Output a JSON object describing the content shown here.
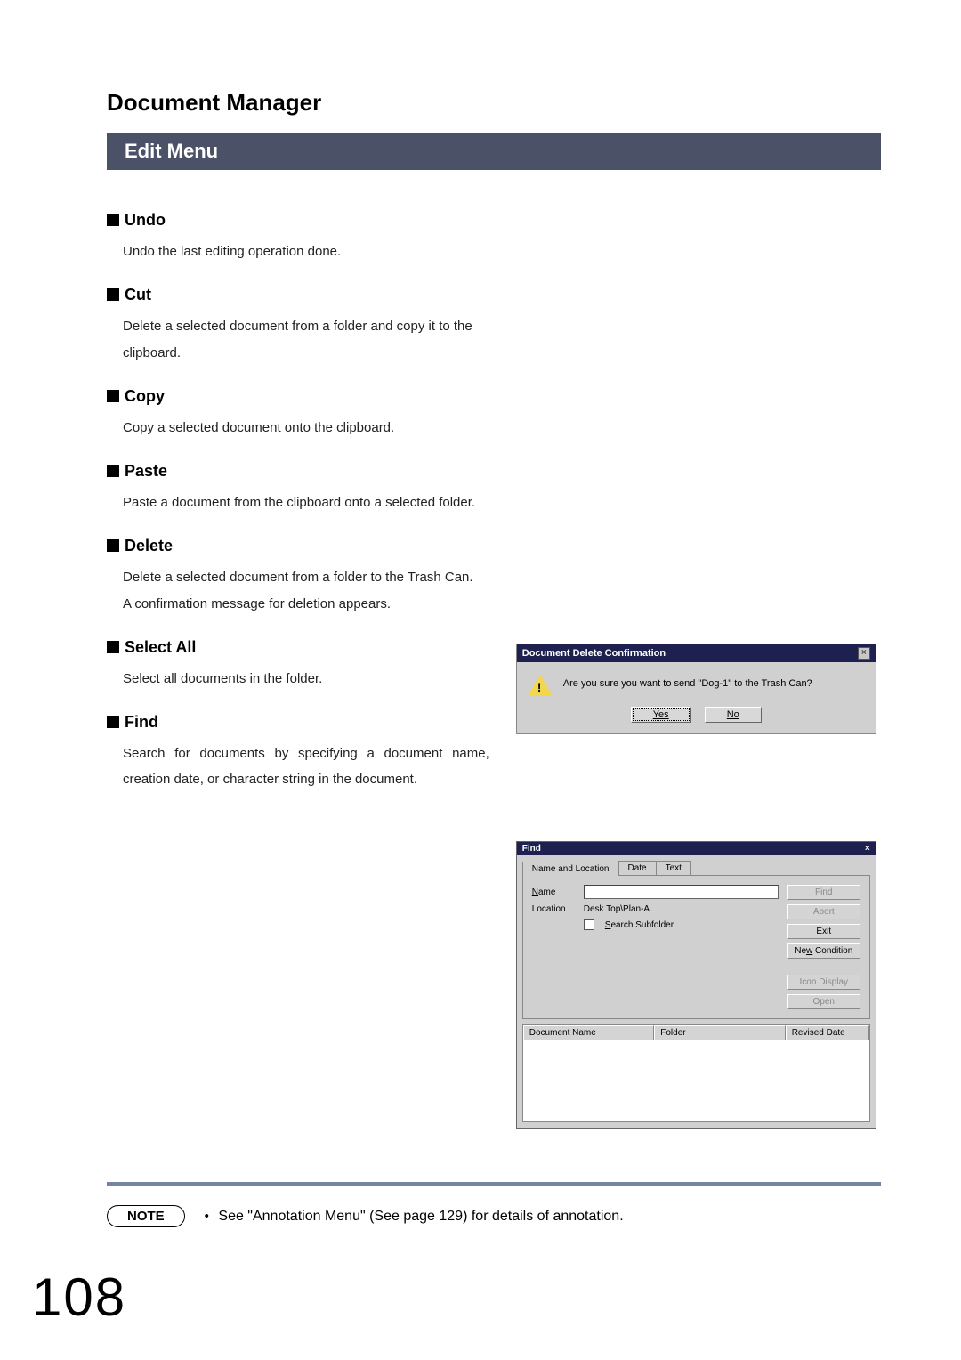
{
  "page_title": "Document Manager",
  "section_bar": "Edit Menu",
  "items": {
    "undo": {
      "h": "Undo",
      "t": "Undo the last editing operation done."
    },
    "cut": {
      "h": "Cut",
      "t": "Delete a selected document from a folder and copy it to the clipboard."
    },
    "copy": {
      "h": "Copy",
      "t": "Copy a selected document onto the clipboard."
    },
    "paste": {
      "h": "Paste",
      "t": "Paste a document from the clipboard onto a selected folder."
    },
    "delete": {
      "h": "Delete",
      "t1": "Delete a selected document from a folder to the Trash Can.",
      "t2": "A confirmation message for deletion appears."
    },
    "selectall": {
      "h": "Select All",
      "t": "Select all documents in the folder."
    },
    "find": {
      "h": "Find",
      "t": "Search for documents by specifying a document name, creation date, or character string in the document."
    }
  },
  "dialog_confirm": {
    "title": "Document Delete Confirmation",
    "msg": "Are you sure you want to send \"Dog-1\" to the Trash Can?",
    "yes": "Yes",
    "no": "No"
  },
  "dialog_find": {
    "title": "Find",
    "tabs": {
      "t1": "Name and Location",
      "t2": "Date",
      "t3": "Text"
    },
    "name_label": "Name",
    "location_label": "Location",
    "location_value": "Desk Top\\Plan-A",
    "search_subfolder": "Search Subfolder",
    "btns": {
      "find": "Find",
      "abort": "Abort",
      "exit": "Exit",
      "newcond": "New Condition",
      "iconize": "Icon Display",
      "open": "Open"
    },
    "cols": {
      "c1": "Document Name",
      "c2": "Folder",
      "c3": "Revised Date"
    }
  },
  "note": {
    "label": "NOTE",
    "text_a": "See \"Annotation Menu\" (See page ",
    "text_page": "129",
    "text_b": ") for details of annotation."
  },
  "page_number": "108"
}
